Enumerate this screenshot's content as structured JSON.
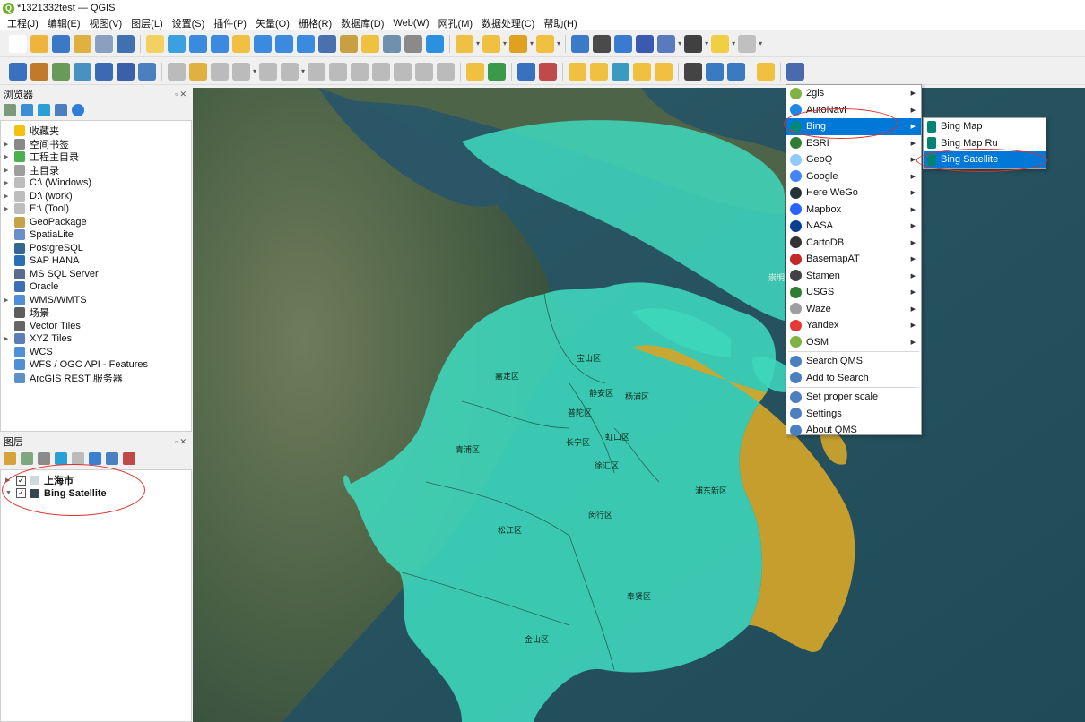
{
  "window": {
    "title": "*1321332test — QGIS"
  },
  "menubar": [
    "工程(J)",
    "编辑(E)",
    "视图(V)",
    "图层(L)",
    "设置(S)",
    "插件(P)",
    "矢量(O)",
    "栅格(R)",
    "数据库(D)",
    "Web(W)",
    "网孔(M)",
    "数据处理(C)",
    "帮助(H)"
  ],
  "browser": {
    "title": "浏览器",
    "items": [
      {
        "label": "收藏夹",
        "arrow": false,
        "color": "#f4c20d"
      },
      {
        "label": "空间书签",
        "arrow": true,
        "color": "#888888"
      },
      {
        "label": "工程主目录",
        "arrow": true,
        "color": "#4caf50"
      },
      {
        "label": "主目录",
        "arrow": true,
        "color": "#9e9e9e"
      },
      {
        "label": "C:\\ (Windows)",
        "arrow": true,
        "color": "#bdbdbd"
      },
      {
        "label": "D:\\ (work)",
        "arrow": true,
        "color": "#bdbdbd"
      },
      {
        "label": "E:\\ (Tool)",
        "arrow": true,
        "color": "#bdbdbd"
      },
      {
        "label": "GeoPackage",
        "arrow": false,
        "color": "#c8a24a"
      },
      {
        "label": "SpatiaLite",
        "arrow": false,
        "color": "#6b8ec7"
      },
      {
        "label": "PostgreSQL",
        "arrow": false,
        "color": "#336791"
      },
      {
        "label": "SAP HANA",
        "arrow": false,
        "color": "#2a6fb5"
      },
      {
        "label": "MS SQL Server",
        "arrow": false,
        "color": "#5b6c8c"
      },
      {
        "label": "Oracle",
        "arrow": false,
        "color": "#3c6fb3"
      },
      {
        "label": "WMS/WMTS",
        "arrow": true,
        "color": "#4f8fd6"
      },
      {
        "label": "场景",
        "arrow": false,
        "color": "#5d5d5d"
      },
      {
        "label": "Vector Tiles",
        "arrow": false,
        "color": "#666666"
      },
      {
        "label": "XYZ Tiles",
        "arrow": true,
        "color": "#5a7fb6"
      },
      {
        "label": "WCS",
        "arrow": false,
        "color": "#4f8fd6"
      },
      {
        "label": "WFS / OGC API - Features",
        "arrow": false,
        "color": "#4f8fd6"
      },
      {
        "label": "ArcGIS REST 服务器",
        "arrow": false,
        "color": "#5d8fc9"
      }
    ]
  },
  "layers": {
    "title": "图层",
    "items": [
      {
        "label": "上海市",
        "checked": "✓",
        "icon_color": "#cfd8dc"
      },
      {
        "label": "Bing Satellite",
        "checked": "✓",
        "icon_color": "#37474f"
      }
    ]
  },
  "qms_menu": [
    {
      "label": "2gis",
      "color": "#7cb342",
      "sub": true
    },
    {
      "label": "AutoNavi",
      "color": "#1e88e5",
      "sub": true
    },
    {
      "label": "Bing",
      "color": "#00897b",
      "sub": true,
      "selected": true
    },
    {
      "label": "ESRI",
      "color": "#2e7d32",
      "sub": true
    },
    {
      "label": "GeoQ",
      "color": "#90caf9",
      "sub": true
    },
    {
      "label": "Google",
      "color": "#4285f4",
      "sub": true
    },
    {
      "label": "Here WeGo",
      "color": "#263238",
      "sub": true
    },
    {
      "label": "Mapbox",
      "color": "#2962ff",
      "sub": true
    },
    {
      "label": "NASA",
      "color": "#0b3d91",
      "sub": true
    },
    {
      "label": "CartoDB",
      "color": "#333333",
      "sub": true
    },
    {
      "label": "BasemapAT",
      "color": "#c62828",
      "sub": true
    },
    {
      "label": "Stamen",
      "color": "#424242",
      "sub": true
    },
    {
      "label": "USGS",
      "color": "#2e7d32",
      "sub": true
    },
    {
      "label": "Waze",
      "color": "#9e9e9e",
      "sub": true
    },
    {
      "label": "Yandex",
      "color": "#e53935",
      "sub": true
    },
    {
      "label": "OSM",
      "color": "#7cb342",
      "sub": true
    }
  ],
  "qms_actions": [
    {
      "label": "Search QMS"
    },
    {
      "label": "Add to Search"
    },
    {
      "label": "Set proper scale"
    },
    {
      "label": "Settings"
    },
    {
      "label": "About QMS"
    }
  ],
  "bing_submenu": [
    {
      "label": "Bing Map"
    },
    {
      "label": "Bing Map Ru"
    },
    {
      "label": "Bing Satellite",
      "selected": true
    }
  ],
  "map": {
    "districts": [
      "宝山区",
      "嘉定区",
      "静安区",
      "杨浦区",
      "普陀区",
      "长宁区",
      "虹口区",
      "徐汇区",
      "青浦区",
      "浦东新区",
      "闵行区",
      "松江区",
      "奉贤区",
      "金山区"
    ],
    "edge_label": "崇明",
    "colors": {
      "district_fill": "#3fd8bd",
      "pudong_fill": "#d4a52a",
      "accent": "#0078d7"
    }
  }
}
